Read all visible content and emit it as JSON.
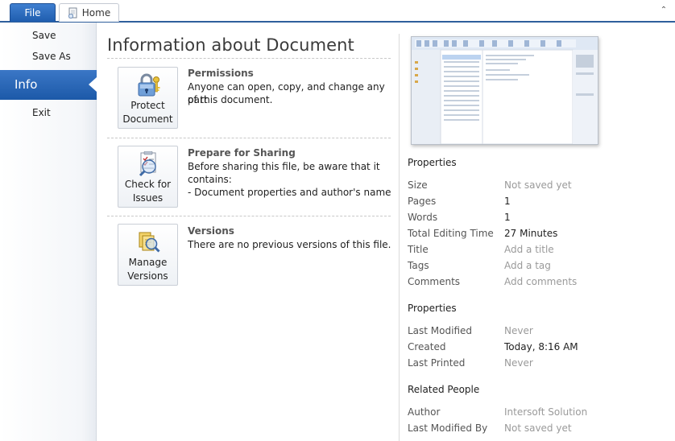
{
  "tabs": {
    "file": "File",
    "home": "Home"
  },
  "nav": {
    "save": "Save",
    "save_as": "Save As",
    "info": "Info",
    "exit": "Exit"
  },
  "main": {
    "title": "Information about Document",
    "sections": [
      {
        "button_label_1": "Protect",
        "button_label_2": "Document",
        "title": "Permissions",
        "text_1": "Anyone can open, copy, and change any part",
        "text_2": "of this document."
      },
      {
        "button_label_1": "Check for",
        "button_label_2": "Issues",
        "title": "Prepare for Sharing",
        "text_1": "Before sharing this file, be aware that it",
        "text_2": "contains:",
        "text_3": "- Document properties and author's name"
      },
      {
        "button_label_1": "Manage",
        "button_label_2": "Versions",
        "title": "Versions",
        "text_1": "There are no previous versions of this file."
      }
    ]
  },
  "properties": {
    "heading": "Properties",
    "rows": [
      {
        "label": "Size",
        "value": "Not saved yet"
      },
      {
        "label": "Pages",
        "value": "1"
      },
      {
        "label": "Words",
        "value": "1"
      },
      {
        "label": "Total Editing Time",
        "value": "27 Minutes"
      },
      {
        "label": "Title",
        "value": "Add a title"
      },
      {
        "label": "Tags",
        "value": "Add a tag"
      },
      {
        "label": "Comments",
        "value": "Add comments"
      }
    ]
  },
  "dates": {
    "heading": "Properties",
    "rows": [
      {
        "label": "Last Modified",
        "value": "Never"
      },
      {
        "label": "Created",
        "value": "Today, 8:16 AM"
      },
      {
        "label": "Last Printed",
        "value": "Never"
      }
    ]
  },
  "people": {
    "heading": "Related People",
    "rows": [
      {
        "label": "Author",
        "value": "Intersoft Solution"
      },
      {
        "label": "Last Modified By",
        "value": "Not saved yet"
      }
    ]
  },
  "icons": {
    "home_tab": "document-icon",
    "collapse": "chevron-up-icon",
    "protect": "lock-key-icon",
    "check": "checklist-icon",
    "versions": "magnifier-documents-icon"
  },
  "colors": {
    "accent": "#1f5dae",
    "muted_text": "#9a9a9a"
  }
}
